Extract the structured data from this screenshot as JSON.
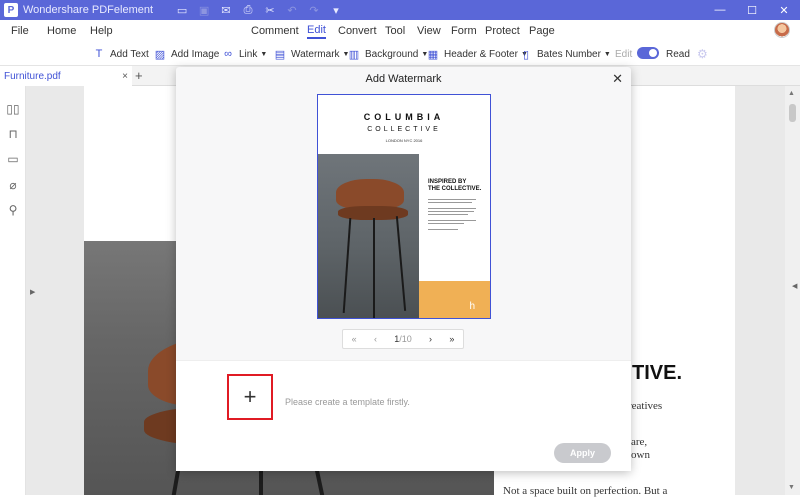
{
  "app": {
    "title": "Wondershare PDFelement",
    "logo_letter": "P",
    "quick_icons": [
      "folder-icon",
      "save-icon",
      "email-icon",
      "print-icon",
      "cut-icon",
      "undo-icon",
      "redo-icon",
      "dropdown-icon"
    ]
  },
  "window_controls": {
    "minimize": "—",
    "maximize": "☐",
    "close": "✕"
  },
  "menu": {
    "items": [
      "File",
      "Home",
      "Help",
      "Comment",
      "Edit",
      "Convert",
      "Tool",
      "View",
      "Form",
      "Protect",
      "Page"
    ],
    "active": "Edit"
  },
  "toolbar": {
    "add_text": "Add Text",
    "add_image": "Add Image",
    "link": "Link",
    "watermark": "Watermark",
    "background": "Background",
    "header_footer": "Header & Footer",
    "bates_number": "Bates Number",
    "edit": "Edit",
    "read": "Read"
  },
  "tab": {
    "name": "Furniture.pdf",
    "close": "×",
    "add": "+"
  },
  "document": {
    "big_text": "TIVE.",
    "line1": "reatives",
    "line2": "are,",
    "line3": "own",
    "line4": "Not a space built on perfection. But a"
  },
  "dialog": {
    "title": "Add Watermark",
    "close": "✕",
    "preview": {
      "brand": "COLUMBIA",
      "sub": "COLLECTIVE",
      "tiny": "LONDON NYC 2016",
      "heading_line1": "INSPIRED BY",
      "heading_line2": "THE COLLECTIVE.",
      "corner_letter": "h"
    },
    "pager": {
      "first": "«",
      "prev": "‹",
      "current": "1",
      "total": "/10",
      "next": "›",
      "last": "»"
    },
    "add_template_symbol": "+",
    "hint": "Please create a template firstly.",
    "apply": "Apply"
  }
}
